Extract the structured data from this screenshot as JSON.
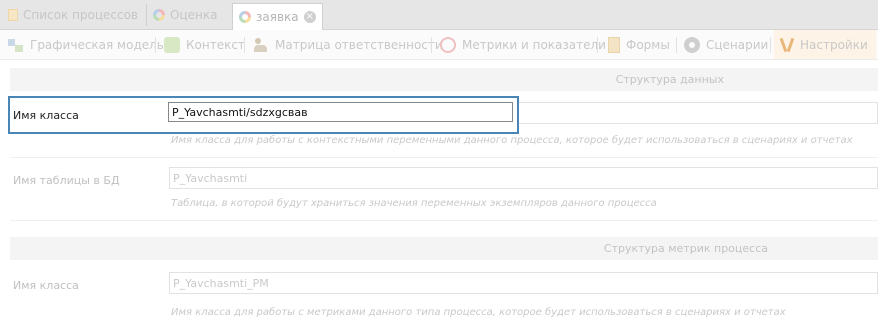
{
  "tabs": [
    {
      "label": "Список процессов",
      "icon": "document-icon"
    },
    {
      "label": "Оценка",
      "icon": "ring-icon"
    },
    {
      "label": "заявка",
      "icon": "ring-icon",
      "active": true,
      "close": "×"
    }
  ],
  "toolbar": {
    "items": [
      {
        "label": "Графическая модель",
        "icon": "graph-icon"
      },
      {
        "label": "Контекст",
        "icon": "puzzle-icon"
      },
      {
        "label": "Матрица ответственности",
        "icon": "people-icon"
      },
      {
        "label": "Метрики и показатели",
        "icon": "gauge-icon"
      },
      {
        "label": "Формы",
        "icon": "form-icon"
      },
      {
        "label": "Сценарии",
        "icon": "gear-icon"
      },
      {
        "label": "Настройки",
        "icon": "tools-icon",
        "active": true
      }
    ]
  },
  "sections": {
    "data_structure": {
      "title": "Структура данных",
      "class_name": {
        "label": "Имя класса",
        "value": "P_Yavchasmti/sdzxgcвав",
        "hint": "Имя класса для работы с контекстными переменными данного процесса, которое будет использоваться в сценариях и отчетах"
      },
      "table_name": {
        "label": "Имя таблицы в БД",
        "value": "P_Yavchasmti",
        "hint": "Таблица, в которой будут храниться значения переменных экземпляров данного процесса"
      }
    },
    "metrics_structure": {
      "title": "Структура метрик процесса",
      "class_name": {
        "label": "Имя класса",
        "value": "P_Yavchasmti_PM",
        "hint": "Имя класса для работы с метриками данного типа процесса, которое будет использоваться в сценариях и отчетах"
      }
    }
  },
  "colors": {
    "highlight_border": "#4a85b8",
    "active_toolbar_bg": "#fdf3e6"
  }
}
